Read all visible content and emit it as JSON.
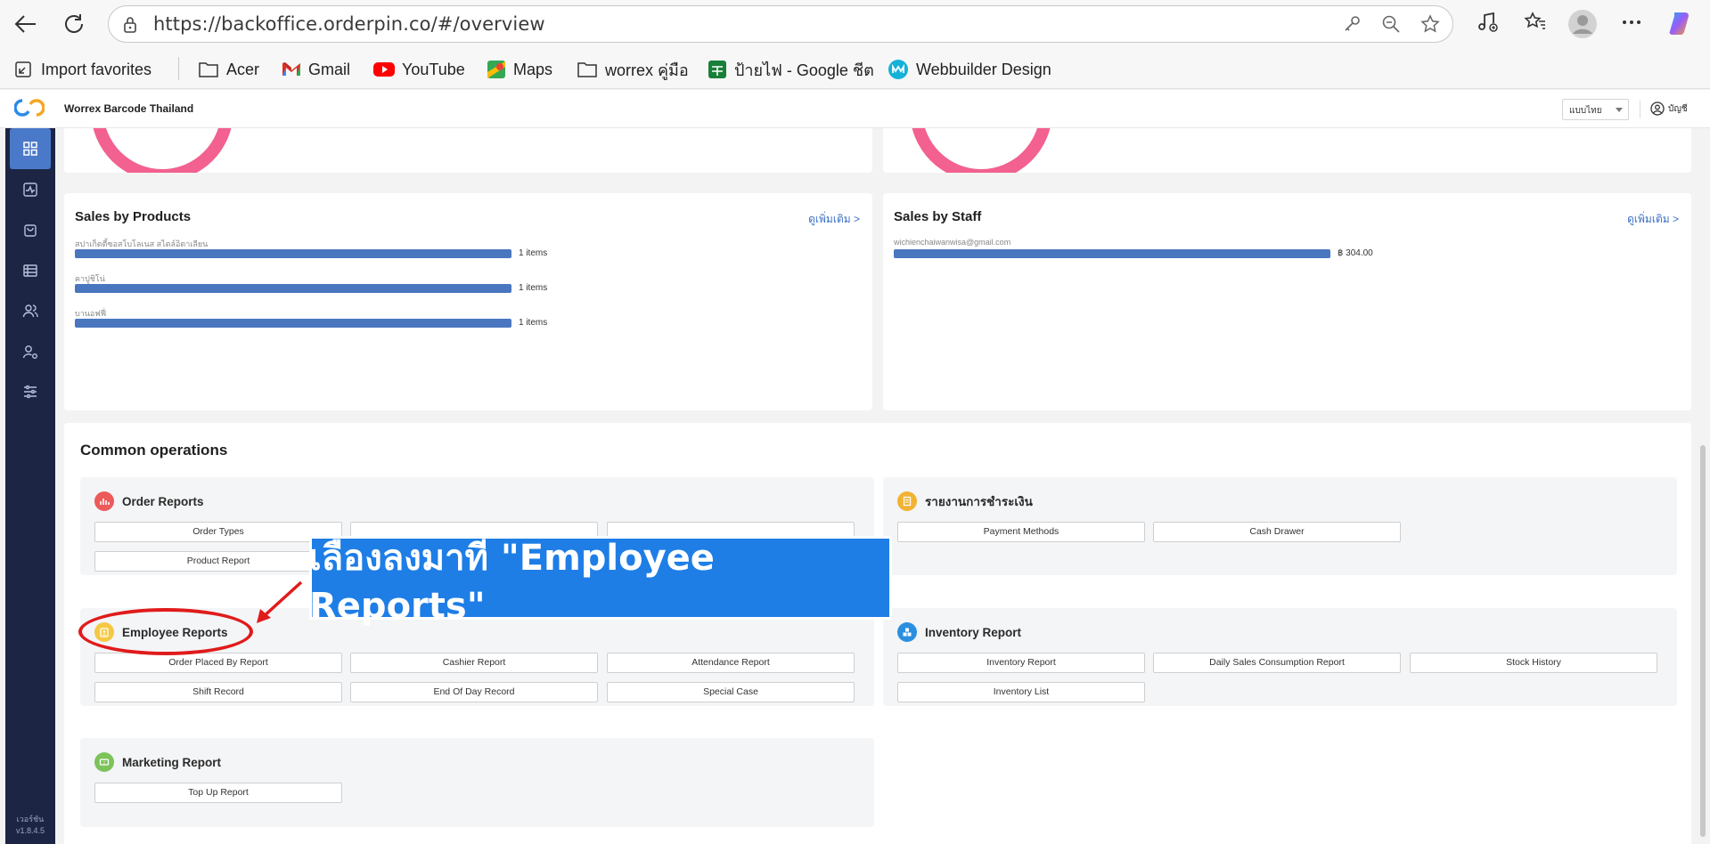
{
  "browser": {
    "url": "https://backoffice.orderpin.co/#/overview",
    "bookmarks": [
      {
        "label": "Import favorites",
        "icon": "import-icon"
      },
      {
        "label": "Acer",
        "icon": "folder-icon"
      },
      {
        "label": "Gmail",
        "icon": "gmail-icon"
      },
      {
        "label": "YouTube",
        "icon": "youtube-icon"
      },
      {
        "label": "Maps",
        "icon": "maps-icon"
      },
      {
        "label": "worrex คู่มือ",
        "icon": "folder-icon"
      },
      {
        "label": "ป้ายไฟ - Google ชีต",
        "icon": "sheets-icon"
      },
      {
        "label": "Webbuilder Design",
        "icon": "webbuilder-icon"
      }
    ]
  },
  "header": {
    "title": "Worrex Barcode Thailand",
    "language": "แบบไทย",
    "account": "บัญชี"
  },
  "sidebar": {
    "items": [
      "overview-icon",
      "activity-icon",
      "shopping-bag-icon",
      "database-icon",
      "users-icon",
      "user-settings-icon",
      "sliders-icon"
    ],
    "version_label": "เวอร์ชัน",
    "version": "v1.8.4.5"
  },
  "sales_by_products": {
    "title": "Sales by Products",
    "more": "ดูเพิ่มเติม >",
    "items": [
      {
        "name": "สปาเก็ตตี้ซอสโบโลเนส สไตล์อิตาเลียน",
        "value": "1 items",
        "fraction": 1.0
      },
      {
        "name": "คาปูชิโน่",
        "value": "1 items",
        "fraction": 1.0
      },
      {
        "name": "บานอฟฟี่",
        "value": "1 items",
        "fraction": 1.0
      }
    ]
  },
  "sales_by_staff": {
    "title": "Sales by Staff",
    "more": "ดูเพิ่มเติม >",
    "items": [
      {
        "name": "wichienchaiwanwisa@gmail.com",
        "value": "฿ 304.00",
        "fraction": 1.0
      }
    ]
  },
  "common_operations": {
    "title": "Common operations",
    "order_reports": {
      "title": "Order Reports",
      "buttons": [
        "Order Types",
        "",
        "",
        "Product Report"
      ]
    },
    "payment_reports": {
      "title": "รายงานการชำระเงิน",
      "buttons": [
        "Payment Methods",
        "Cash Drawer"
      ]
    },
    "employee_reports": {
      "title": "Employee Reports",
      "buttons": [
        "Order Placed By Report",
        "Cashier Report",
        "Attendance Report",
        "Shift Record",
        "End Of Day Record",
        "Special Case"
      ]
    },
    "inventory_report": {
      "title": "Inventory Report",
      "buttons": [
        "Inventory Report",
        "Daily Sales Consumption Report",
        "Stock History",
        "Inventory List"
      ]
    },
    "marketing_report": {
      "title": "Marketing Report",
      "buttons": [
        "Top Up Report"
      ]
    }
  },
  "annotation": {
    "text": "เลื่องลงมาที่ \"Employee Reports\""
  },
  "colors": {
    "accent": "#4a76c0",
    "sidebar": "#1d2544",
    "annotation_bg": "#1e7ee6",
    "highlight": "#e01b1b"
  }
}
